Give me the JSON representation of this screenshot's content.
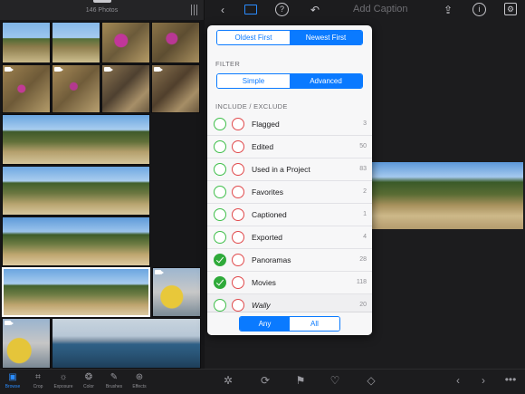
{
  "left_header": {
    "photo_count": "146 Photos"
  },
  "top_bar": {
    "caption_placeholder": "Add Caption",
    "help_icon": "?",
    "info_icon": "i"
  },
  "sort": {
    "options": [
      "Oldest First",
      "Newest First"
    ],
    "selected": "Newest First"
  },
  "filter": {
    "heading": "FILTER",
    "options": [
      "Simple",
      "Advanced"
    ],
    "selected": "Advanced"
  },
  "include_exclude": {
    "heading": "INCLUDE / EXCLUDE",
    "rows": [
      {
        "label": "Flagged",
        "count": "3",
        "included": false
      },
      {
        "label": "Edited",
        "count": "50",
        "included": false
      },
      {
        "label": "Used in a Project",
        "count": "83",
        "included": false
      },
      {
        "label": "Favorites",
        "count": "2",
        "included": false
      },
      {
        "label": "Captioned",
        "count": "1",
        "included": false
      },
      {
        "label": "Exported",
        "count": "4",
        "included": false
      },
      {
        "label": "Panoramas",
        "count": "28",
        "included": true
      },
      {
        "label": "Movies",
        "count": "118",
        "included": true
      },
      {
        "label": "Wally",
        "count": "20",
        "included": false
      }
    ]
  },
  "match": {
    "options": [
      "Any",
      "All"
    ],
    "selected": "Any"
  },
  "tools": [
    {
      "label": "Browse",
      "icon": "browse-icon"
    },
    {
      "label": "Crop",
      "icon": "crop-icon"
    },
    {
      "label": "Exposure",
      "icon": "exposure-icon"
    },
    {
      "label": "Color",
      "icon": "color-icon"
    },
    {
      "label": "Brushes",
      "icon": "brushes-icon"
    },
    {
      "label": "Effects",
      "icon": "effects-icon"
    }
  ],
  "colors": {
    "accent": "#0a7aff",
    "include_green": "#2faa3a",
    "exclude_red": "#e0494b"
  }
}
